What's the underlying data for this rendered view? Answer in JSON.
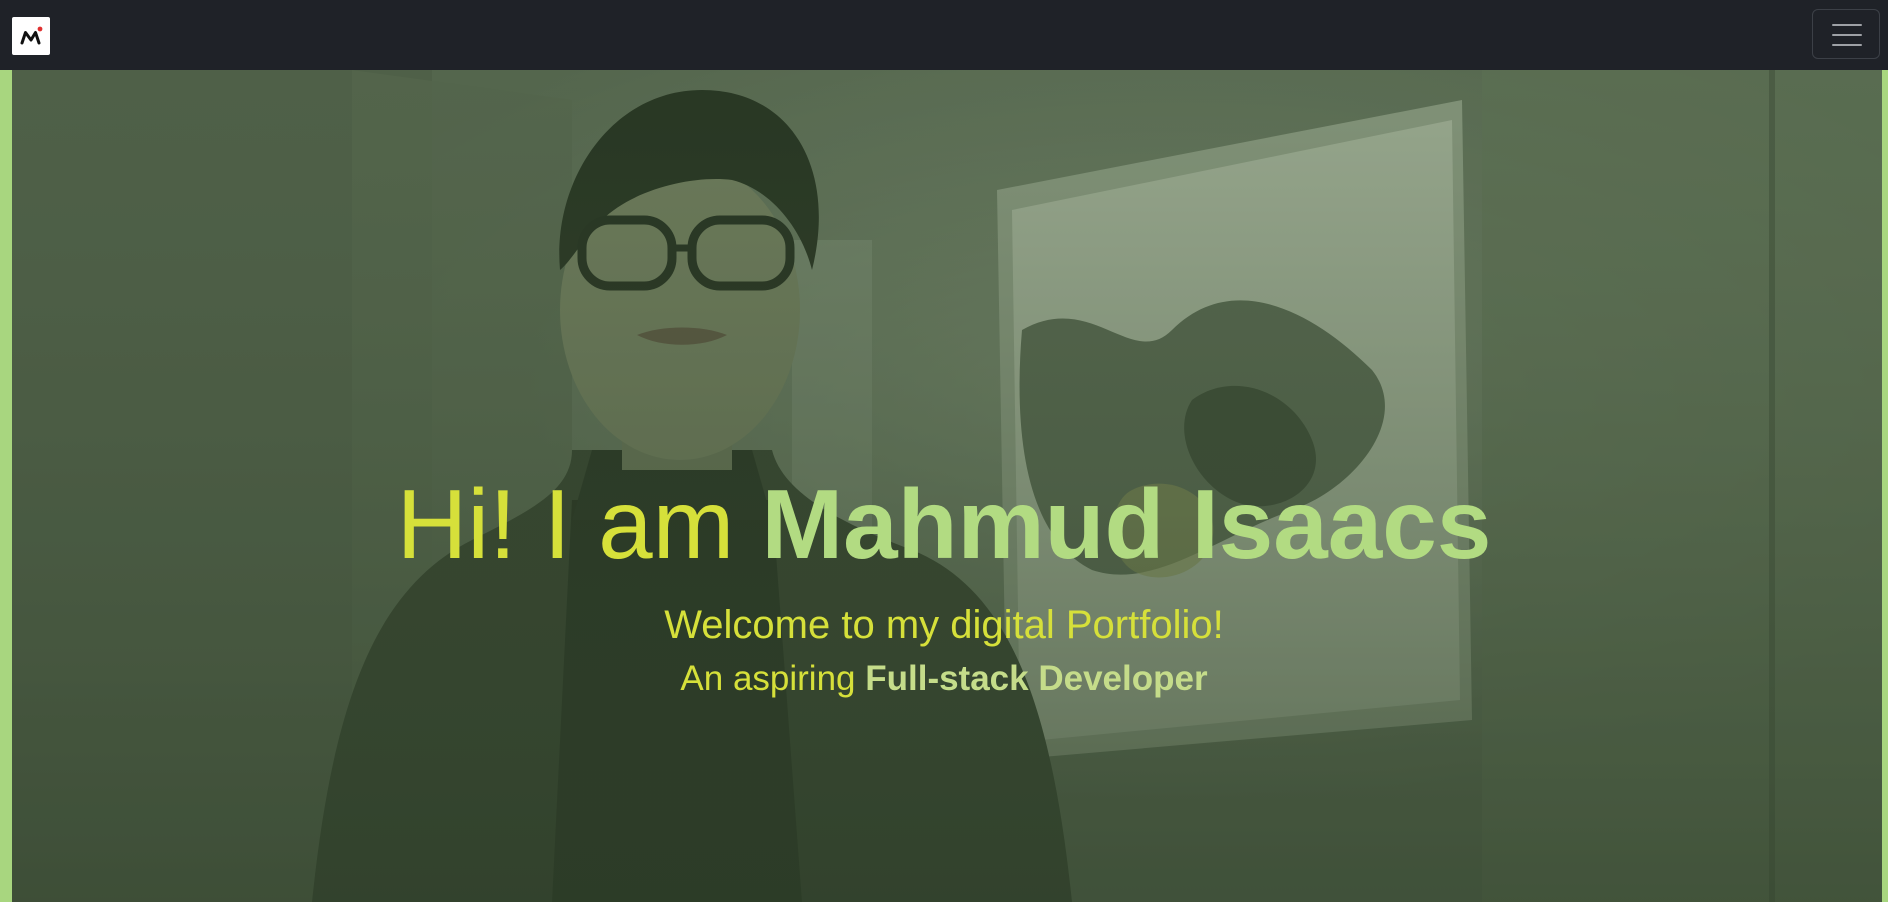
{
  "navbar": {
    "brand_icon": "mi-logo-icon",
    "menu_icon": "hamburger-menu-icon",
    "background": "#1f2228"
  },
  "hero": {
    "greeting": "Hi! I am ",
    "name": "Mahmud Isaacs",
    "welcome": "Welcome to my digital Portfolio!",
    "role_prefix": "An aspiring ",
    "role": "Full-stack Developer",
    "colors": {
      "greeting": "#d6e03a",
      "name": "#b2db82",
      "role_strong": "#c5dc8a",
      "accent": "#a8d67f"
    }
  }
}
